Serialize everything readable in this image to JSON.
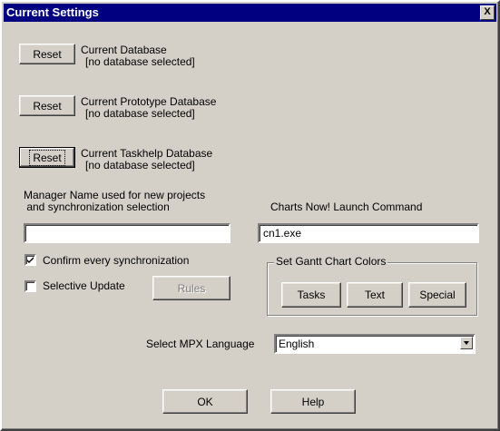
{
  "window": {
    "title": "Current Settings",
    "close_label": "X"
  },
  "databases": [
    {
      "reset_label": "Reset",
      "title": "Current Database",
      "status": "[no database selected]"
    },
    {
      "reset_label": "Reset",
      "title": "Current Prototype Database",
      "status": "[no database selected]"
    },
    {
      "reset_label": "Reset",
      "title": "Current Taskhelp Database",
      "status": "[no database selected]"
    }
  ],
  "manager": {
    "label_line1": "Manager Name used for new projects",
    "label_line2": " and synchronization selection",
    "value": ""
  },
  "charts_now": {
    "label": "Charts Now! Launch Command",
    "value": "cn1.exe"
  },
  "options": {
    "confirm_label": "Confirm every synchronization",
    "confirm_checked": true,
    "selective_label": "Selective Update",
    "selective_checked": false,
    "rules_label": "Rules"
  },
  "gantt": {
    "group_label": "Set Gantt Chart Colors",
    "tasks_label": "Tasks",
    "text_label": "Text",
    "special_label": "Special"
  },
  "mpx": {
    "label": "Select MPX Language",
    "value": "English"
  },
  "footer": {
    "ok_label": "OK",
    "help_label": "Help"
  }
}
